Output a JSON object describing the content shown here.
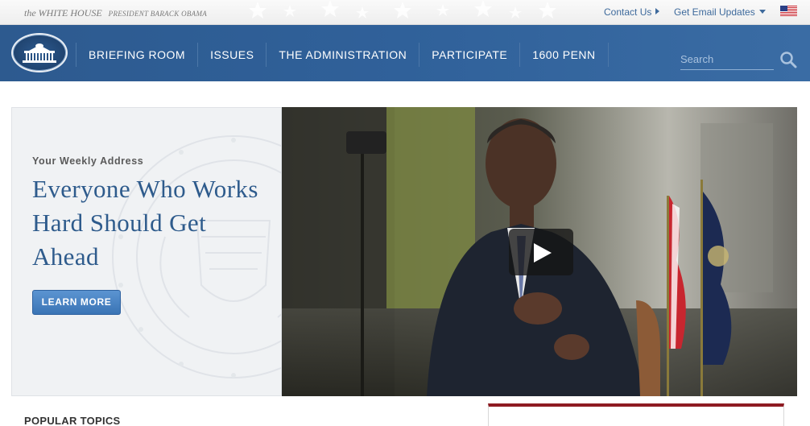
{
  "header": {
    "site_name": "the WHITE HOUSE",
    "site_subtitle": "PRESIDENT BARACK OBAMA",
    "contact_label": "Contact Us",
    "email_updates_label": "Get Email Updates",
    "flag_icon": "us-flag-icon"
  },
  "nav": {
    "items": [
      {
        "label": "BRIEFING ROOM"
      },
      {
        "label": "ISSUES"
      },
      {
        "label": "THE ADMINISTRATION"
      },
      {
        "label": "PARTICIPATE"
      },
      {
        "label": "1600 PENN"
      }
    ],
    "search_placeholder": "Search",
    "search_icon": "search-icon"
  },
  "hero": {
    "eyebrow": "Your Weekly Address",
    "headline": "Everyone Who Works Hard Should Get Ahead",
    "button_label": "LEARN MORE",
    "video_icon": "play-icon"
  },
  "sections": {
    "popular_topics": "POPULAR TOPICS"
  },
  "colors": {
    "nav_blue": "#30619a",
    "link_blue": "#3e6a9c",
    "headline_blue": "#2e5b8c",
    "panel_accent": "#8e1b22"
  }
}
